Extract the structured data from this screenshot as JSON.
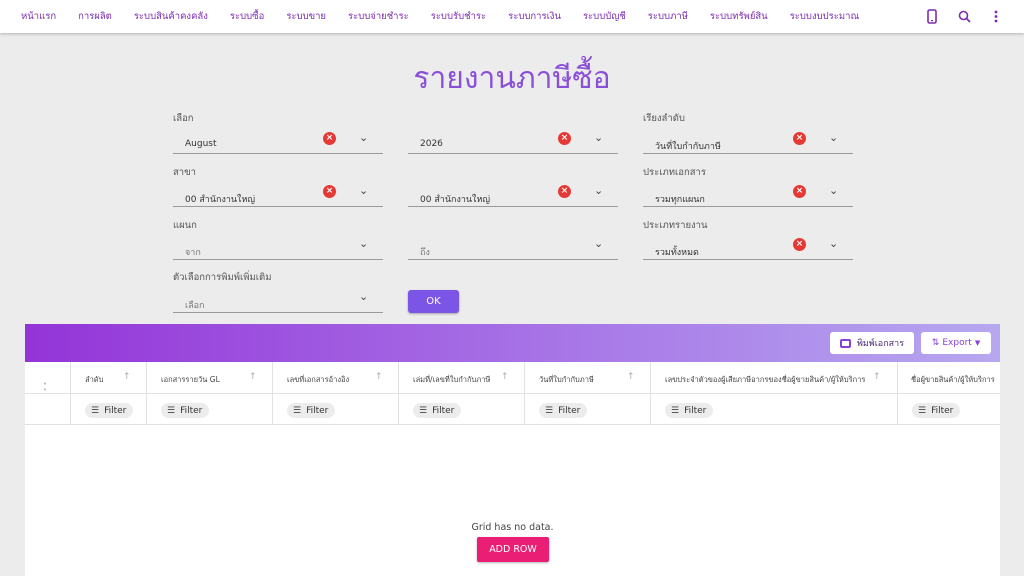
{
  "nav": {
    "items": [
      "หน้าแรก",
      "การผลิต",
      "ระบบสินค้าคงคลัง",
      "ระบบซื้อ",
      "ระบบขาย",
      "ระบบจ่ายชำระ",
      "ระบบรับชำระ",
      "ระบบการเงิน",
      "ระบบบัญชี",
      "ระบบภาษี",
      "ระบบทรัพย์สิน",
      "ระบบงบประมาณ"
    ],
    "icons": [
      "phone-icon",
      "search-icon",
      "more-vert-icon"
    ]
  },
  "page": {
    "title": "รายงานภาษีซื้อ"
  },
  "form": {
    "month_label": "เลือก",
    "month_value": "August",
    "year_value": "2026",
    "sort_label": "เรียงลำดับ",
    "sort_value": "วันที่ใบกำกับภาษี",
    "branch_label": "สาขา",
    "branch_from": "00 สำนักงานใหญ่",
    "branch_to": "00 สำนักงานใหญ่",
    "doctype_label": "ประเภทเอกสาร",
    "doctype_value": "รวมทุกแผนก",
    "dept_label": "แผนก",
    "dept_from_placeholder": "จาก",
    "dept_to_placeholder": "ถึง",
    "reporttype_label": "ประเภทรายงาน",
    "reporttype_value": "รวมทั้งหมด",
    "print_options_label": "ตัวเลือกการพิมพ์เพิ่มเติม",
    "print_options_placeholder": "เลือก",
    "ok_label": "OK"
  },
  "grid": {
    "print_label": "พิมพ์เอกสาร",
    "export_label": "Export",
    "filter_label": "Filter",
    "columns": [
      "ลำดับ",
      "เอกสารรายวัน GL",
      "เลขที่เอกสารอ้างอิง",
      "เล่มที่/เลขที่ใบกำกับภาษี",
      "วันที่ใบกำกับภาษี",
      "เลขประจำตัวของผู้เสียภาษีอากรของชื่อผู้ขายสินค้า/ผู้ให้บริการ",
      "ชื่อผู้ขายสินค้า/ผู้ให้บริการ"
    ],
    "no_data_text": "Grid has no data.",
    "add_row_label": "ADD ROW"
  }
}
